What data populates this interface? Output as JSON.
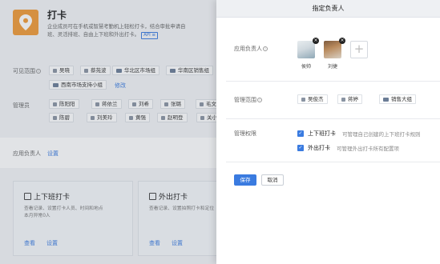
{
  "app": {
    "title": "打卡",
    "description_line1": "企业成员可在手机或智慧考勤机上轻松打卡，结合审批申请自",
    "description_line2": "班、灵活排班、自由上下班和外出打卡。",
    "api_badge": "API ≡"
  },
  "visible_range": {
    "label": "可见范围",
    "tags": [
      "吴晓",
      "蔡苑波",
      "华北区市场组",
      "华南区销售组",
      "西南市场支持小组"
    ],
    "edit": "修改"
  },
  "admins": {
    "label": "管理员",
    "row1": [
      "陈阳阳",
      "蒋依兰",
      "刘希",
      "张璐",
      "毛文"
    ],
    "row2": [
      "陈碧",
      "刘美玲",
      "黄强",
      "赵明登",
      "关小"
    ]
  },
  "owner_row": {
    "label": "应用负责人",
    "setting": "设置"
  },
  "cards": [
    {
      "title": "上下班打卡",
      "desc_line1": "查看记录、设置打卡人员、时间和地点",
      "desc_line2": "本月异常0人",
      "view": "查看",
      "setting": "设置"
    },
    {
      "title": "外出打卡",
      "desc_line1": "查看记录、设置拍照打卡和定位",
      "desc_line2": "",
      "view": "查看",
      "setting": "设置"
    }
  ],
  "panel": {
    "title": "指定负责人",
    "owner_label": "应用负责人",
    "owners": [
      {
        "name": "侯帅"
      },
      {
        "name": "刘捷"
      }
    ],
    "scope_label": "管理范围",
    "scope_tags": [
      "吴俊杰",
      "蒋婷",
      "销售大组"
    ],
    "permission_label": "管理权限",
    "permissions": [
      {
        "title": "上下班打卡",
        "desc": "可管理自己创建的上下班打卡规则"
      },
      {
        "title": "外出打卡",
        "desc": "可管理外出打卡所有配置项"
      }
    ],
    "save": "保存",
    "cancel": "取消"
  },
  "colors": {
    "accent": "#3a7be0",
    "app_icon": "#f19a36"
  }
}
